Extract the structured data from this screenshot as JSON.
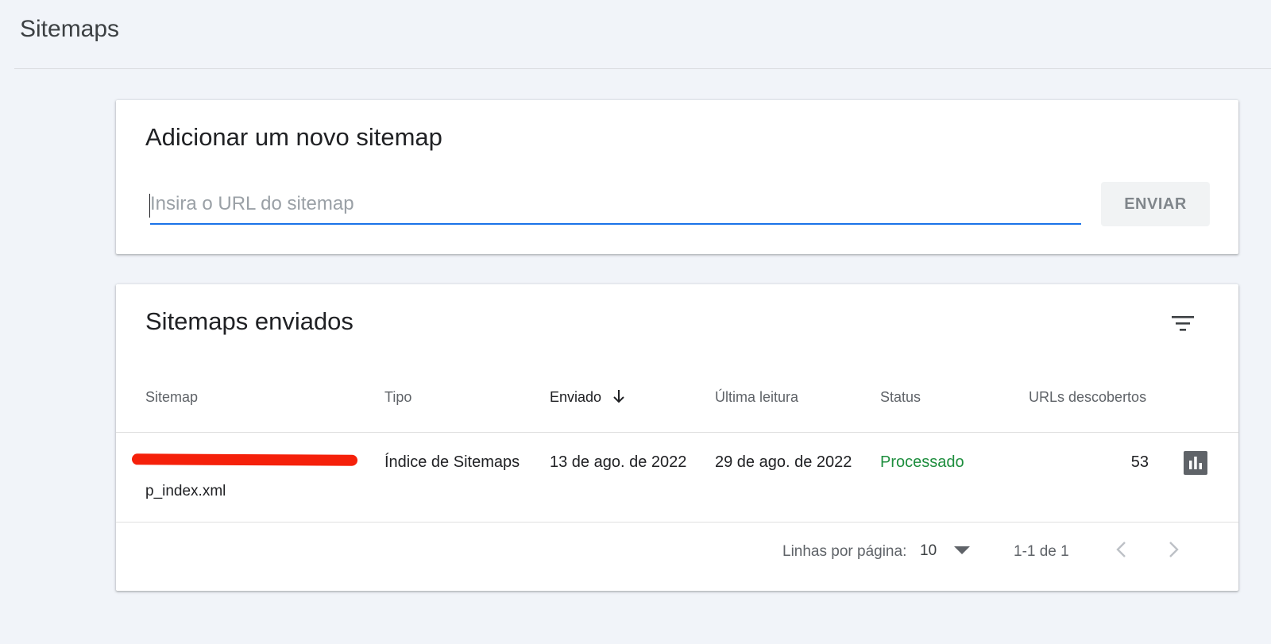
{
  "page": {
    "title": "Sitemaps"
  },
  "add_sitemap": {
    "heading": "Adicionar um novo sitemap",
    "input_placeholder": "Insira o URL do sitemap",
    "input_value": "",
    "submit_label": "ENVIAR"
  },
  "submitted": {
    "heading": "Sitemaps enviados",
    "columns": {
      "sitemap": "Sitemap",
      "type": "Tipo",
      "submitted": "Enviado",
      "last_read": "Última leitura",
      "status": "Status",
      "urls": "URLs descobertos"
    },
    "sort": {
      "column": "Enviado",
      "direction": "descending",
      "icon": "arrow-down-icon"
    },
    "rows": [
      {
        "sitemap": "p_index.xml",
        "type": "Índice de Sitemaps",
        "submitted": "13 de ago. de 2022",
        "last_read": "29 de ago. de 2022",
        "status": "Processado",
        "urls": "53"
      }
    ],
    "footer": {
      "rows_per_page_label": "Linhas por página:",
      "rows_per_page_value": "10",
      "range": "1-1 de 1"
    }
  },
  "icons": {
    "filter": "filter-list-icon",
    "chart": "bar-chart-icon",
    "dropdown": "arrow-drop-down-icon",
    "prev": "chevron-left-icon",
    "next": "chevron-right-icon"
  },
  "colors": {
    "accent": "#1a73e8",
    "status_ok": "#1e8e3e",
    "background": "#f1f4f9",
    "redaction": "#f5200a"
  }
}
